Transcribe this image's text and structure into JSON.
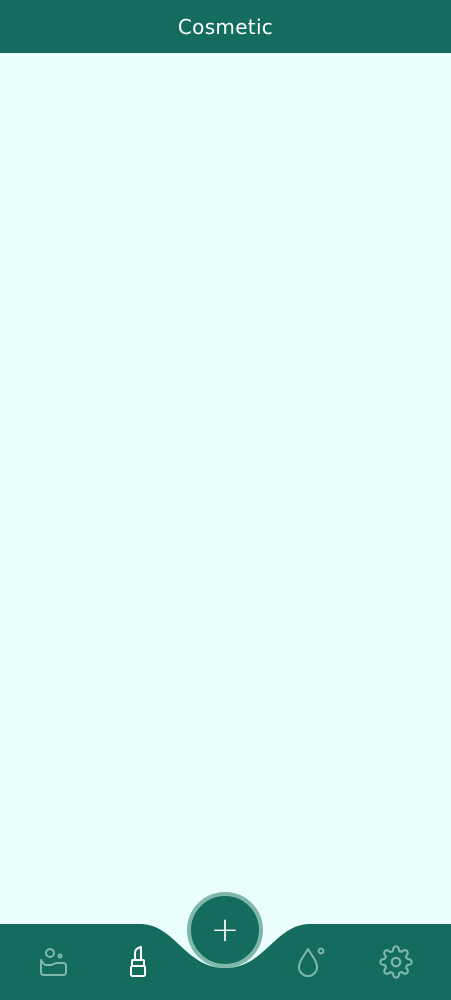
{
  "app_bar": {
    "title": "Cosmetic"
  },
  "colors": {
    "primary": "#146c5f",
    "background": "#ebfefe",
    "fab_ring": "#7fb8aa",
    "icon_inactive": "#7fb8aa",
    "icon_active": "#ffffff"
  },
  "bottom_nav": {
    "items": [
      {
        "icon": "skincare-icon",
        "active": false
      },
      {
        "icon": "lipstick-icon",
        "active": true
      },
      {
        "icon": "drop-icon",
        "active": false
      },
      {
        "icon": "gear-icon",
        "active": false
      }
    ],
    "fab_icon": "plus-icon",
    "fab_symbol": "+"
  }
}
